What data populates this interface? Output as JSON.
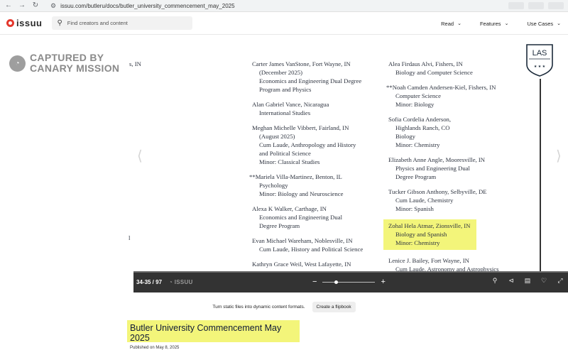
{
  "browser": {
    "url": "issuu.com/butleru/docs/butler_university_commencement_may_2025"
  },
  "header": {
    "logo_text": "issuu",
    "search_placeholder": "Find creators and content",
    "menu": [
      {
        "label": "Read"
      },
      {
        "label": "Features"
      },
      {
        "label": "Use Cases"
      }
    ]
  },
  "watermark": {
    "line1": "CAPTURED BY",
    "line2": "CANARY MISSION"
  },
  "badge": {
    "text": "LAS"
  },
  "left_page": {
    "fragment": "s, IN",
    "stray_mark": "l",
    "entries": [
      {
        "name": "Carter James VanStone, Fort Wayne, IN",
        "details": [
          "(December 2025)",
          "Economics and Engineering Dual Degree",
          "Program and Physics"
        ]
      },
      {
        "name": "Alan Gabriel Vance, Nicaragua",
        "details": [
          "International Studies"
        ]
      },
      {
        "name": "Meghan Michelle Vibbert, Fairland, IN",
        "details": [
          "(August 2025)",
          "Cum Laude, Anthropology and History",
          "and Political Science",
          "Minor: Classical Studies"
        ]
      },
      {
        "name": "**Mariela Villa-Martinez, Benton, IL",
        "details": [
          "Psychology",
          "Minor: Biology and Neuroscience"
        ]
      },
      {
        "name": "Alexa K Walker, Carthage, IN",
        "details": [
          "Economics and Engineering Dual",
          "Degree Program"
        ]
      },
      {
        "name": "Evan Michael Wareham, Noblesville, IN",
        "details": [
          "Cum Laude, History and Political Science"
        ]
      },
      {
        "name": "Kathryn Grace Weil, West Lafayette, IN",
        "details": []
      }
    ]
  },
  "right_page": {
    "entries": [
      {
        "name": "Alea Firdaus Alvi, Fishers, IN",
        "details": [
          "Biology and Computer Science"
        ]
      },
      {
        "name": "**Noah Camden Andersen-Kiel, Fishers, IN",
        "details": [
          "Computer Science",
          "Minor: Biology"
        ]
      },
      {
        "name": "Sofia Cordelia Anderson,",
        "details": [
          "Highlands Ranch, CO",
          "Biology",
          "Minor: Chemistry"
        ]
      },
      {
        "name": "Elizabeth Anne Angle, Mooresville, IN",
        "details": [
          "Physics and Engineering Dual",
          "Degree Program"
        ]
      },
      {
        "name": "Tucker Gibson Anthony, Selbyville, DE",
        "details": [
          "Cum Laude, Chemistry",
          "Minor: Spanish"
        ]
      },
      {
        "name": "Zohal Hela Atmar, Zionsville, IN",
        "details": [
          "Biology and Spanish",
          "Minor: Chemistry"
        ],
        "highlighted": true
      },
      {
        "name": "Lenice J. Bailey, Fort Wayne, IN",
        "details": [
          "Cum Laude, Astronomy and Astrophysics"
        ]
      }
    ]
  },
  "toolbar": {
    "page_indicator": "34-35 / 97",
    "logo_text": "ISSUU",
    "zoom_level": 0.25
  },
  "promo": {
    "text": "Turn static files into dynamic content formats.",
    "button": "Create a flipbook"
  },
  "document": {
    "title": "Butler University Commencement May 2025",
    "published": "Published on May 8, 2025"
  },
  "colors": {
    "highlight": "#f3f57a",
    "toolbar_bg": "#333333",
    "brand_red": "#e4372c"
  }
}
